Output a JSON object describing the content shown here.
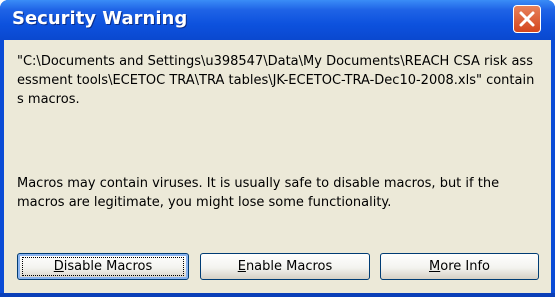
{
  "dialog": {
    "title": "Security Warning",
    "message": "\"C:\\Documents and Settings\\u398547\\Data\\My Documents\\REACH CSA risk assessment tools\\ECETOC TRA\\TRA tables\\JK-ECETOC-TRA-Dec10-2008.xls\" contains macros.",
    "warning": "Macros may contain viruses. It is usually safe to disable macros, but if the macros are legitimate, you might lose some functionality."
  },
  "buttons": {
    "disable": {
      "mnemonic": "D",
      "rest": "isable Macros"
    },
    "enable": {
      "mnemonic": "E",
      "rest": "nable Macros"
    },
    "more_info": {
      "mnemonic": "M",
      "rest": "ore Info"
    }
  },
  "icons": {
    "close": "close-icon"
  },
  "colors": {
    "titlebar": "#0a4bd6",
    "client": "#ece9d8",
    "close_button": "#d4461e"
  }
}
